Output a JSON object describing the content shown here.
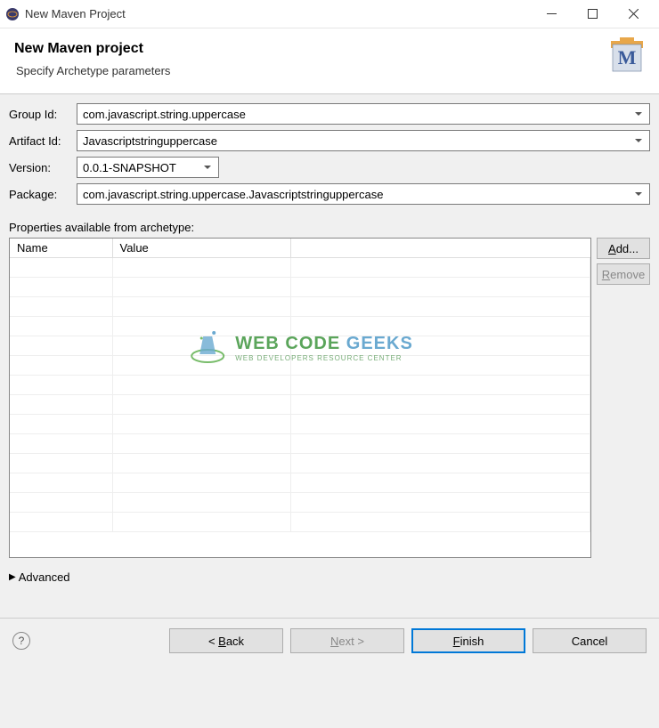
{
  "window": {
    "title": "New Maven Project"
  },
  "header": {
    "title": "New Maven project",
    "subtitle": "Specify Archetype parameters"
  },
  "form": {
    "group_id_label": "Group Id:",
    "group_id_value": "com.javascript.string.uppercase",
    "artifact_id_label": "Artifact Id:",
    "artifact_id_value": "Javascriptstringuppercase",
    "version_label": "Version:",
    "version_value": "0.0.1-SNAPSHOT",
    "package_label": "Package:",
    "package_value": "com.javascript.string.uppercase.Javascriptstringuppercase"
  },
  "properties": {
    "label": "Properties available from archetype:",
    "col_name": "Name",
    "col_value": "Value",
    "add_btn": "Add...",
    "remove_btn": "Remove"
  },
  "advanced": {
    "label": "Advanced"
  },
  "footer": {
    "back": "< Back",
    "next": "Next >",
    "finish": "Finish",
    "cancel": "Cancel"
  },
  "watermark": {
    "line1a": "WEB CODE ",
    "line1b": "GEEKS",
    "line2": "WEB DEVELOPERS RESOURCE CENTER"
  }
}
